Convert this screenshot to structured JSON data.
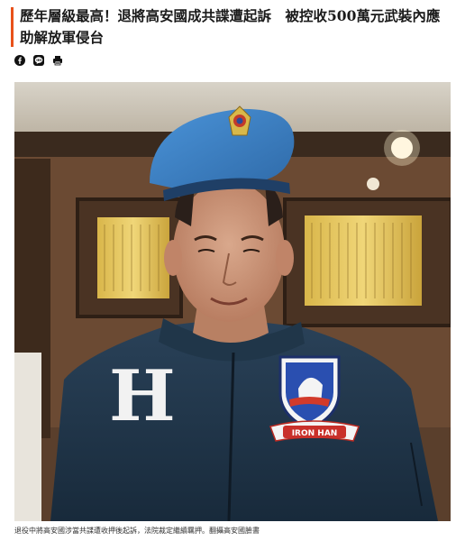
{
  "article": {
    "headline": "歷年層級最高！退將高安國成共諜遭起訴　被控收500萬元武裝內應助解放軍侵台",
    "caption": "退役中將高安國涉當共諜遭收押後起訴，法院裁定繼續羈押。翻攝高安國臉書"
  },
  "share": {
    "icons": [
      "facebook-icon",
      "line-icon",
      "print-icon"
    ]
  },
  "photo": {
    "jacket_letter": "H",
    "patch_text": "IRON HAN"
  },
  "colors": {
    "accent": "#e8511a",
    "beret": "#3b7fc4",
    "jacket": "#1f3347"
  }
}
